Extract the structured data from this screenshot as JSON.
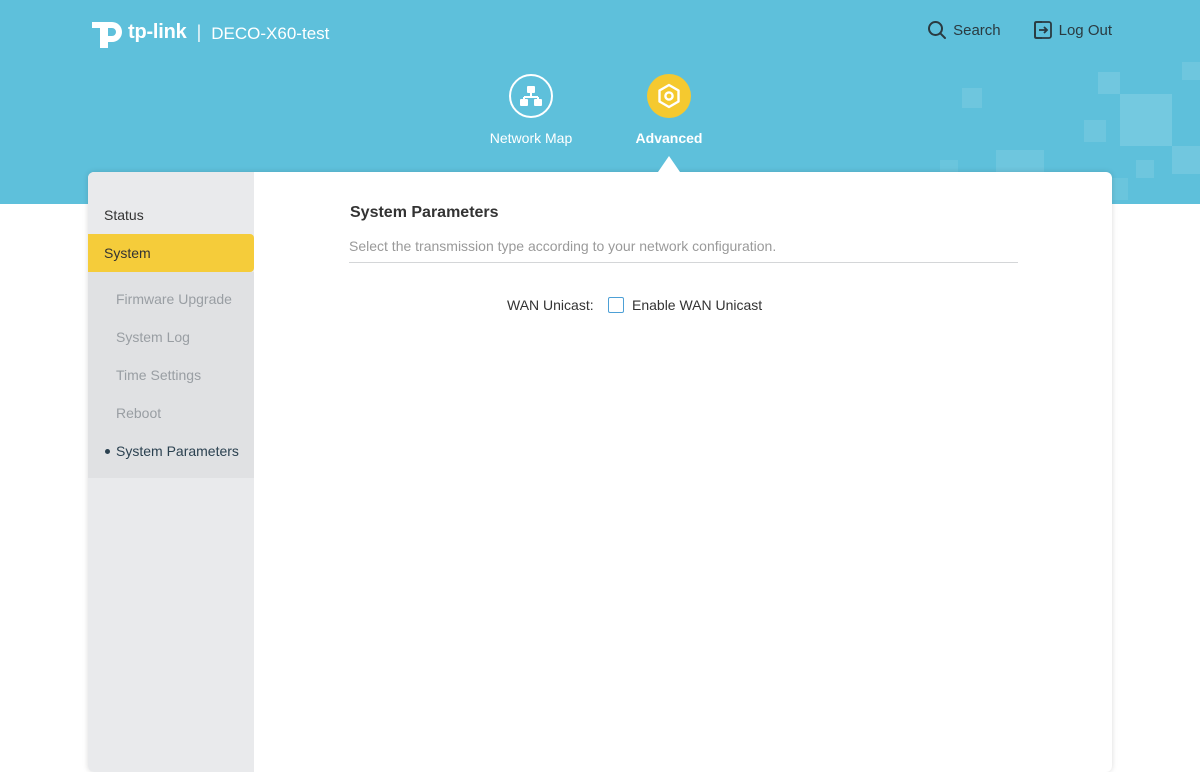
{
  "header": {
    "brand_text": "tp-link",
    "separator": "|",
    "device_name": "DECO-X60-test",
    "search_label": "Search",
    "logout_label": "Log Out"
  },
  "nav": {
    "tabs": [
      {
        "label": "Network Map",
        "icon": "network-map-icon"
      },
      {
        "label": "Advanced",
        "icon": "advanced-gear-icon"
      }
    ],
    "active": "Advanced"
  },
  "sidebar": {
    "items": [
      {
        "label": "Status"
      },
      {
        "label": "System"
      }
    ],
    "active": "System",
    "subitems": [
      {
        "label": "Firmware Upgrade"
      },
      {
        "label": "System Log"
      },
      {
        "label": "Time Settings"
      },
      {
        "label": "Reboot"
      },
      {
        "label": "System Parameters"
      }
    ],
    "current_sub": "System Parameters"
  },
  "main": {
    "title": "System Parameters",
    "description": "Select the transmission type according to your network configuration.",
    "wan_unicast": {
      "label": "WAN Unicast:",
      "checkbox_label": "Enable WAN Unicast",
      "checked": false
    }
  },
  "colors": {
    "header_bg": "#5ec0db",
    "accent_yellow": "#f5c92f",
    "sidebar_bg": "#e9eaec",
    "checkbox_border": "#4da0d6"
  }
}
